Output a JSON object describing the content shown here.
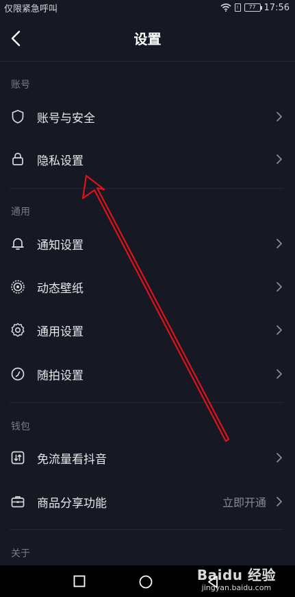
{
  "status_bar": {
    "carrier": "仅限紧急呼叫",
    "battery": "77",
    "time": "17:56"
  },
  "header": {
    "title": "设置"
  },
  "sections": {
    "account": {
      "header": "账号",
      "items": [
        {
          "label": "账号与安全",
          "icon": "shield-icon"
        },
        {
          "label": "隐私设置",
          "icon": "lock-icon"
        }
      ]
    },
    "general": {
      "header": "通用",
      "items": [
        {
          "label": "通知设置",
          "icon": "bell-icon"
        },
        {
          "label": "动态壁纸",
          "icon": "live-wallpaper-icon"
        },
        {
          "label": "通用设置",
          "icon": "gear-icon"
        },
        {
          "label": "随拍设置",
          "icon": "camera-timer-icon"
        }
      ]
    },
    "wallet": {
      "header": "钱包",
      "items": [
        {
          "label": "免流量看抖音",
          "icon": "data-free-icon"
        },
        {
          "label": "商品分享功能",
          "icon": "briefcase-icon",
          "extra": "立即开通"
        }
      ]
    },
    "about": {
      "header": "关于"
    }
  },
  "watermark": {
    "brand": "Baidu 经验",
    "url": "jingyan.baidu.com"
  },
  "colors": {
    "background": "#161823",
    "annotation_arrow": "#e0121a"
  }
}
